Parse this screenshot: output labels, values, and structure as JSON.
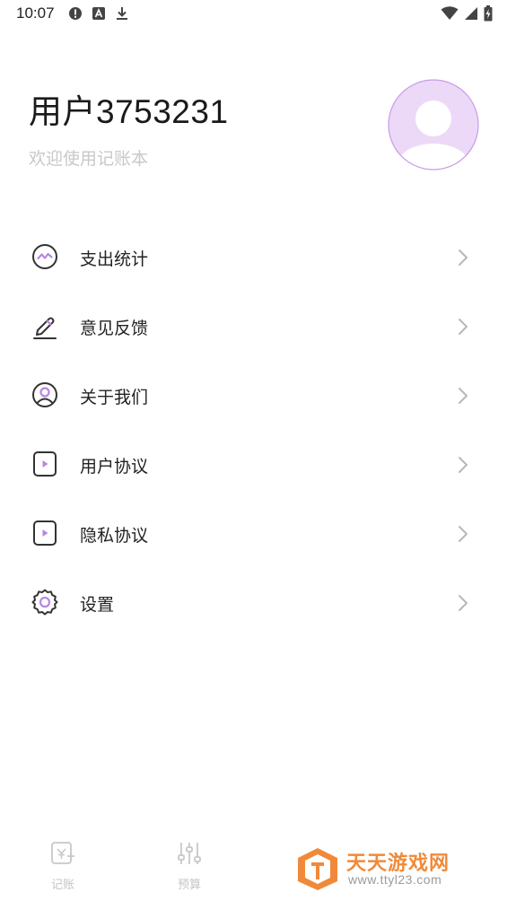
{
  "status_bar": {
    "time": "10:07",
    "left_icons": [
      "alert-icon",
      "app-a-icon",
      "download-icon"
    ],
    "right_icons": [
      "wifi-icon",
      "signal-icon",
      "battery-charging-icon"
    ]
  },
  "profile": {
    "username": "用户3753231",
    "subtitle": "欢迎使用记账本",
    "avatar_icon": "default-avatar-icon"
  },
  "menu": {
    "items": [
      {
        "label": "支出统计",
        "icon": "trend-chart-icon"
      },
      {
        "label": "意见反馈",
        "icon": "pencil-icon"
      },
      {
        "label": "关于我们",
        "icon": "user-circle-icon"
      },
      {
        "label": "用户协议",
        "icon": "document-play-icon"
      },
      {
        "label": "隐私协议",
        "icon": "document-play-icon"
      },
      {
        "label": "设置",
        "icon": "gear-icon"
      }
    ]
  },
  "bottom_nav": {
    "items": [
      {
        "label": "记账",
        "icon": "bookkeeping-icon"
      },
      {
        "label": "预算",
        "icon": "budget-sliders-icon"
      }
    ]
  },
  "watermark": {
    "title": "天天游戏网",
    "url": "www.ttyl23.com"
  },
  "colors": {
    "accent": "#b887e0",
    "avatar_bg": "#ecd9f7",
    "icon_stroke": "#333333",
    "chevron": "#b8b8b8",
    "subtitle": "#c8c8c8",
    "watermark_orange": "#f08a3a"
  }
}
